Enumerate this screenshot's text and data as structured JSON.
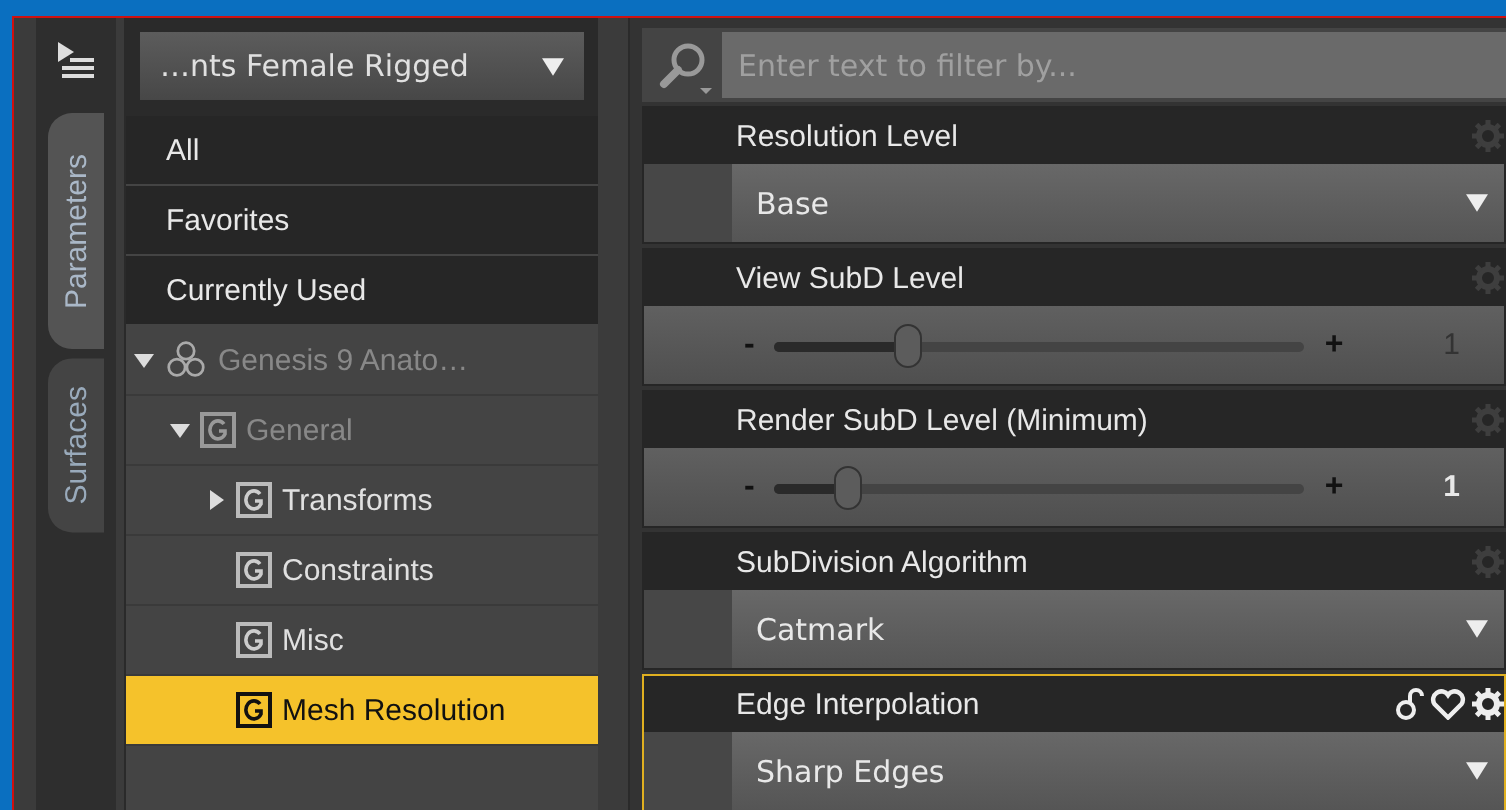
{
  "side_tabs": [
    {
      "label": "Parameters",
      "selected": true
    },
    {
      "label": "Surfaces",
      "selected": false
    }
  ],
  "node_selector": {
    "value": "…nts Female Rigged"
  },
  "filters": [
    {
      "label": "All"
    },
    {
      "label": "Favorites"
    },
    {
      "label": "Currently Used"
    }
  ],
  "tree": [
    {
      "label": "Genesis 9 Anato…",
      "kind": "figure",
      "expanded": true,
      "disabled": true,
      "selected": false,
      "children": [
        {
          "label": "General",
          "kind": "group",
          "expanded": true,
          "disabled": true,
          "selected": false,
          "children": [
            {
              "label": "Transforms",
              "kind": "group",
              "expanded": false,
              "disabled": false,
              "selected": false
            },
            {
              "label": "Constraints",
              "kind": "group",
              "disabled": false,
              "selected": false
            },
            {
              "label": "Misc",
              "kind": "group",
              "disabled": false,
              "selected": false
            },
            {
              "label": "Mesh Resolution",
              "kind": "group",
              "disabled": false,
              "selected": true
            }
          ]
        }
      ]
    }
  ],
  "search": {
    "placeholder": "Enter text to filter by..."
  },
  "properties": [
    {
      "label": "Resolution Level",
      "kind": "dropdown",
      "value": "Base",
      "selected": false
    },
    {
      "label": "View SubD Level",
      "kind": "slider",
      "level": 0.25,
      "value": "1",
      "minus": "-",
      "plus": "+",
      "selected": false,
      "disabled": true
    },
    {
      "label": "Render SubD Level (Minimum)",
      "kind": "slider",
      "level": 0.14,
      "value": "1",
      "minus": "-",
      "plus": "+",
      "selected": false,
      "disabled": false
    },
    {
      "label": "SubDivision Algorithm",
      "kind": "dropdown",
      "value": "Catmark",
      "selected": false
    },
    {
      "label": "Edge Interpolation",
      "kind": "dropdown",
      "value": "Sharp Edges",
      "selected": true
    }
  ]
}
